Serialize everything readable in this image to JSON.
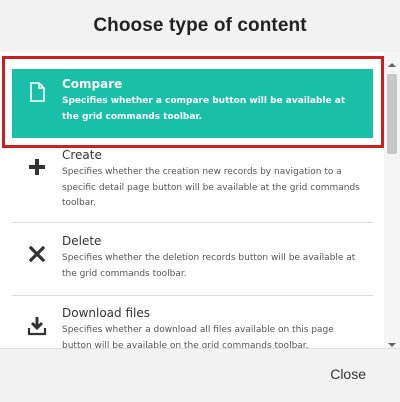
{
  "dialog": {
    "title": "Choose type of content",
    "close_label": "Close"
  },
  "items": [
    {
      "name": "Compare",
      "description": "Specifies whether a compare button will be available at the grid commands toolbar.",
      "icon": "document-icon",
      "selected": true
    },
    {
      "name": "Create",
      "description": "Specifies whether the creation new records by navigation to a specific detail page button will be available at the grid commands toolbar.",
      "icon": "plus-icon",
      "selected": false
    },
    {
      "name": "Delete",
      "description": "Specifies whether the deletion records button will be available at the grid commands toolbar.",
      "icon": "x-icon",
      "selected": false
    },
    {
      "name": "Download files",
      "description": "Specifies whether a download all files available on this page button will be available on the grid commands toolbar.",
      "icon": "download-icon",
      "selected": false
    }
  ],
  "colors": {
    "selected_bg": "#1abfa8",
    "highlight_border": "#cc1f1f"
  }
}
